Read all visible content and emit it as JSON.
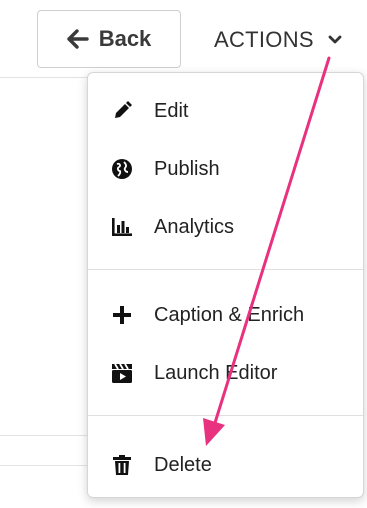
{
  "toolbar": {
    "back_label": "Back",
    "back_icon": "arrow-left-icon",
    "actions_label": "ACTIONS",
    "actions_icon": "chevron-down-icon"
  },
  "menu": {
    "items": [
      {
        "label": "Edit",
        "icon": "pencil-icon"
      },
      {
        "label": "Publish",
        "icon": "globe-icon"
      },
      {
        "label": "Analytics",
        "icon": "bar-chart-icon"
      },
      {
        "label": "Caption & Enrich",
        "icon": "plus-icon"
      },
      {
        "label": "Launch Editor",
        "icon": "clapperboard-icon"
      },
      {
        "label": "Delete",
        "icon": "trash-icon"
      }
    ]
  },
  "annotation": {
    "color": "#e8327f"
  }
}
